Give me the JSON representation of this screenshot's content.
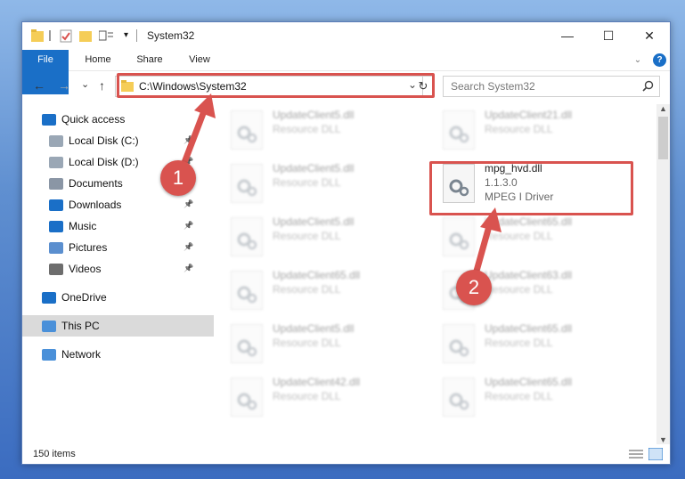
{
  "window": {
    "title": "System32",
    "minimize": "—",
    "maximize": "☐",
    "close": "✕"
  },
  "ribbon": {
    "tabs": [
      "File",
      "Home",
      "Share",
      "View"
    ],
    "help": "?"
  },
  "nav": {
    "back": "←",
    "forward": "→",
    "recent": "⌄",
    "up": "↑",
    "address": "C:\\Windows\\System32",
    "dropdown": "⌄",
    "refresh": "↻",
    "search_placeholder": "Search System32"
  },
  "sidebar": [
    {
      "label": "Quick access",
      "icon": "star-icon",
      "color": "#1a6fc7",
      "pinned": false,
      "selected": false
    },
    {
      "label": "Local Disk (C:)",
      "icon": "drive-icon",
      "color": "#9aa7b5",
      "pinned": true,
      "selected": false
    },
    {
      "label": "Local Disk (D:)",
      "icon": "drive-icon",
      "color": "#9aa7b5",
      "pinned": true,
      "selected": false
    },
    {
      "label": "Documents",
      "icon": "documents-icon",
      "color": "#8a96a5",
      "pinned": true,
      "selected": false
    },
    {
      "label": "Downloads",
      "icon": "downloads-icon",
      "color": "#1a6fc7",
      "pinned": true,
      "selected": false
    },
    {
      "label": "Music",
      "icon": "music-icon",
      "color": "#1a6fc7",
      "pinned": true,
      "selected": false
    },
    {
      "label": "Pictures",
      "icon": "pictures-icon",
      "color": "#5b8fcf",
      "pinned": true,
      "selected": false
    },
    {
      "label": "Videos",
      "icon": "videos-icon",
      "color": "#6d6d6d",
      "pinned": true,
      "selected": false
    },
    {
      "label": "OneDrive",
      "icon": "onedrive-icon",
      "color": "#1a6fc7",
      "pinned": false,
      "selected": false
    },
    {
      "label": "This PC",
      "icon": "computer-icon",
      "color": "#4a90d9",
      "pinned": false,
      "selected": true
    },
    {
      "label": "Network",
      "icon": "network-icon",
      "color": "#4a90d9",
      "pinned": false,
      "selected": false
    }
  ],
  "files": [
    {
      "name": "UpdateClient5.dll",
      "desc": "Resource DLL",
      "blurred": true
    },
    {
      "name": "UpdateClient21.dll",
      "desc": "Resource DLL",
      "blurred": true
    },
    {
      "name": "UpdateClient5.dll",
      "desc": "Resource DLL",
      "blurred": true
    },
    {
      "name": "mpg_hvd.dll",
      "version": "1.1.3.0",
      "desc": "MPEG I Driver",
      "blurred": false
    },
    {
      "name": "UpdateClient5.dll",
      "desc": "Resource DLL",
      "blurred": true
    },
    {
      "name": "UpdateClient65.dll",
      "desc": "Resource DLL",
      "blurred": true
    },
    {
      "name": "UpdateClient65.dll",
      "desc": "Resource DLL",
      "blurred": true
    },
    {
      "name": "UpdateClient63.dll",
      "desc": "Resource DLL",
      "blurred": true
    },
    {
      "name": "UpdateClient5.dll",
      "desc": "Resource DLL",
      "blurred": true
    },
    {
      "name": "UpdateClient65.dll",
      "desc": "Resource DLL",
      "blurred": true
    },
    {
      "name": "UpdateClient42.dll",
      "desc": "Resource DLL",
      "blurred": true
    },
    {
      "name": "UpdateClient65.dll",
      "desc": "Resource DLL",
      "blurred": true
    }
  ],
  "status": {
    "items": "150 items"
  },
  "annotations": {
    "step1": "1",
    "step2": "2",
    "color": "#d9534f"
  }
}
